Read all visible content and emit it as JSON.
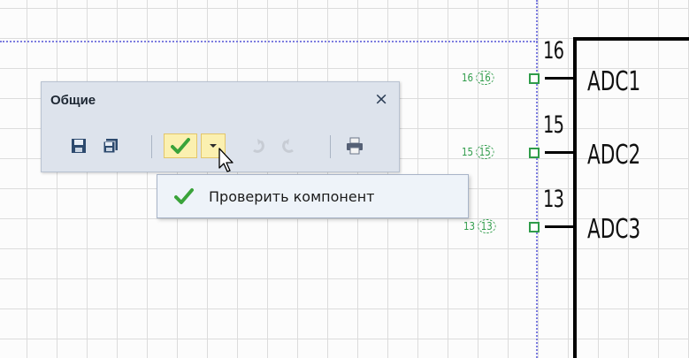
{
  "toolbar": {
    "title": "Общие",
    "close_label": "×",
    "buttons": [
      {
        "icon": "save-icon"
      },
      {
        "icon": "save-all-icon"
      },
      {
        "icon": "check-icon"
      },
      {
        "icon": "dropdown-arrow-icon"
      },
      {
        "icon": "undo-icon"
      },
      {
        "icon": "redo-icon"
      },
      {
        "icon": "print-icon"
      }
    ]
  },
  "menu": {
    "items": [
      {
        "label": "Проверить компонент",
        "icon": "check-icon"
      }
    ]
  },
  "schematic": {
    "pins": [
      {
        "number": "16",
        "name": "ADC1",
        "net_label": "16",
        "net_circle": "16"
      },
      {
        "number": "15",
        "name": "ADC2",
        "net_label": "15",
        "net_circle": "15"
      },
      {
        "number": "13",
        "name": "ADC3",
        "net_label": "13",
        "net_circle": "13"
      }
    ]
  },
  "colors": {
    "grid": "#dcdcdc",
    "guide": "#7c7ce0",
    "pin_green": "#2f9c4a",
    "toolbar_bg": "#dde3ec",
    "menu_bg": "#eef3f9"
  }
}
